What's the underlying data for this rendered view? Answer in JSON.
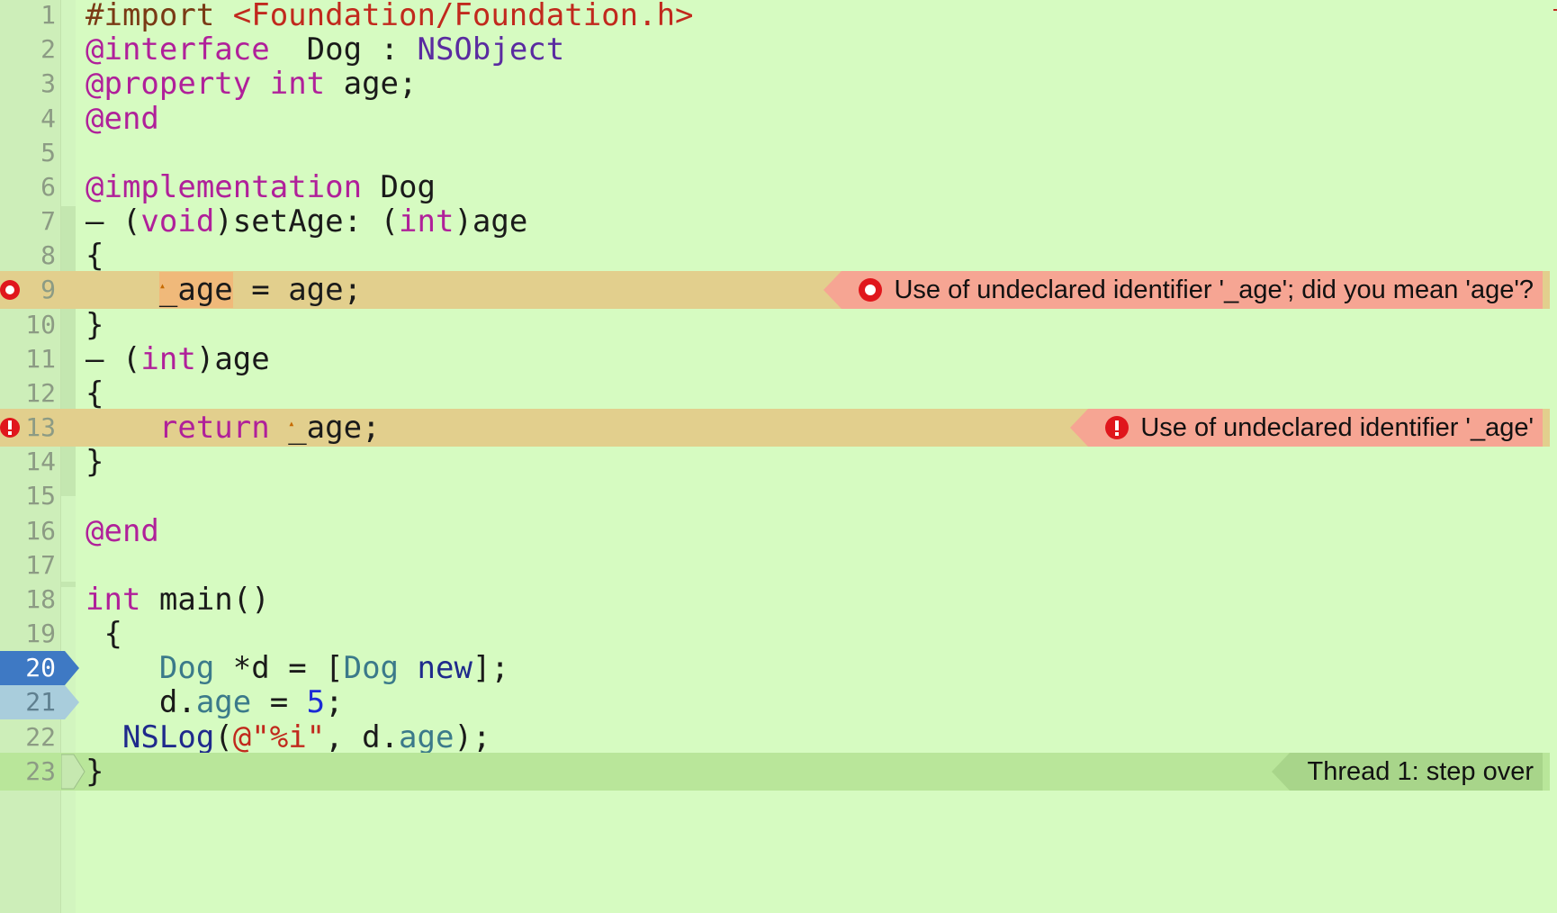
{
  "editor": {
    "lines": [
      {
        "n": "1",
        "t": [
          [
            "pre",
            "#import "
          ],
          [
            "inc",
            "<Foundation/Foundation.h>"
          ]
        ]
      },
      {
        "n": "2",
        "t": [
          [
            "kw",
            "@interface"
          ],
          [
            "",
            "  Dog : "
          ],
          [
            "cls",
            "NSObject"
          ]
        ]
      },
      {
        "n": "3",
        "t": [
          [
            "kw",
            "@property"
          ],
          [
            "",
            " "
          ],
          [
            "kw",
            "int"
          ],
          [
            "",
            " age;"
          ]
        ]
      },
      {
        "n": "4",
        "t": [
          [
            "kw",
            "@end"
          ]
        ]
      },
      {
        "n": "5",
        "t": []
      },
      {
        "n": "6",
        "t": [
          [
            "kw",
            "@implementation"
          ],
          [
            "",
            " Dog"
          ]
        ]
      },
      {
        "n": "7",
        "t": [
          [
            "",
            "– ("
          ],
          [
            "kw",
            "void"
          ],
          [
            "",
            ")setAge: ("
          ],
          [
            "kw",
            "int"
          ],
          [
            "",
            ")age"
          ]
        ]
      },
      {
        "n": "8",
        "t": [
          [
            "",
            "{"
          ]
        ]
      },
      {
        "n": "9",
        "t": [
          [
            "",
            "    "
          ],
          [
            "errtok",
            "_age"
          ],
          [
            "",
            " = age;"
          ]
        ]
      },
      {
        "n": "10",
        "t": [
          [
            "",
            "}"
          ]
        ]
      },
      {
        "n": "11",
        "t": [
          [
            "",
            "– ("
          ],
          [
            "kw",
            "int"
          ],
          [
            "",
            ")age"
          ]
        ]
      },
      {
        "n": "12",
        "t": [
          [
            "",
            "{"
          ]
        ]
      },
      {
        "n": "13",
        "t": [
          [
            "",
            "    "
          ],
          [
            "kw",
            "return"
          ],
          [
            "",
            " "
          ],
          [
            "errtok2",
            "_age"
          ],
          [
            "",
            ";"
          ]
        ]
      },
      {
        "n": "14",
        "t": [
          [
            "",
            "}"
          ]
        ]
      },
      {
        "n": "15",
        "t": []
      },
      {
        "n": "16",
        "t": [
          [
            "kw",
            "@end"
          ]
        ]
      },
      {
        "n": "17",
        "t": []
      },
      {
        "n": "18",
        "t": [
          [
            "kw",
            "int"
          ],
          [
            "",
            " main()"
          ]
        ]
      },
      {
        "n": "19",
        "t": [
          [
            "",
            ", {"
          ]
        ]
      },
      {
        "n": "20",
        "t": [
          [
            "",
            "    "
          ],
          [
            "typ",
            "Dog"
          ],
          [
            "",
            " *d = ["
          ],
          [
            "typ",
            "Dog"
          ],
          [
            "",
            " "
          ],
          [
            "fn",
            "new"
          ],
          [
            "",
            "];"
          ]
        ]
      },
      {
        "n": "21",
        "t": [
          [
            "",
            "    d."
          ],
          [
            "prop",
            "age"
          ],
          [
            "",
            " = "
          ],
          [
            "num",
            "5"
          ],
          [
            "",
            ";"
          ]
        ]
      },
      {
        "n": "22",
        "t": [
          [
            "",
            "  "
          ],
          [
            "fn",
            "NSLog"
          ],
          [
            "",
            "("
          ],
          [
            "str",
            "@\"%i\""
          ],
          [
            "",
            ", d."
          ],
          [
            "prop",
            "age"
          ],
          [
            "",
            ");"
          ]
        ]
      },
      {
        "n": "23",
        "t": [
          [
            "",
            "}"
          ]
        ]
      }
    ]
  },
  "issues": {
    "line9_message": "Use of undeclared identifier '_age'; did you mean 'age'?",
    "line13_message": "Use of undeclared identifier '_age'"
  },
  "debugger": {
    "current_line": "20",
    "next_line": "21",
    "thread_message": "Thread 1: step over"
  },
  "colors": {
    "background": "#d6fbc1",
    "error_line": "#e2cf8d",
    "error_banner": "#f6a593",
    "thread_line": "#b9e69a",
    "pc_blue": "#3e79c4",
    "pc_light": "#a9cddc",
    "keyword": "#b0209a",
    "error_red": "#e0161c"
  }
}
